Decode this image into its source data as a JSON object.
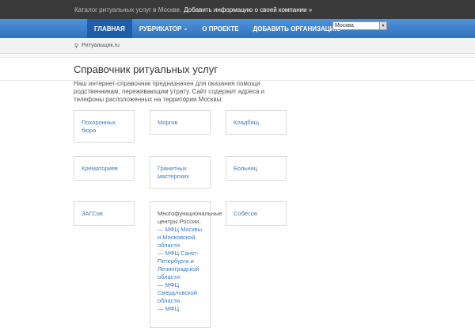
{
  "topbar": {
    "text": "Каталог ритуальных услуг в Москве.",
    "link": "Добавить информацию о своей компании »"
  },
  "nav": {
    "items": [
      {
        "label": "Главная",
        "active": true
      },
      {
        "label": "Рубрикатор",
        "dropdown": true,
        "chevron": "⌄"
      },
      {
        "label": "О проекте"
      },
      {
        "label": "Добавить организацию"
      }
    ],
    "city": "Москва"
  },
  "breadcrumb": {
    "icon": "map-marker-icon",
    "label": "Ритуальщик.ru"
  },
  "page": {
    "title": "Справочник ритуальных услуг",
    "intro": "Наш интернет-справочник предназначен для оказания помощи родственникам, переживающим утрату. Сайт содержит адреса и телефоны расположенных на территории Москвы:"
  },
  "cards": [
    {
      "label": "Похоронных бюро"
    },
    {
      "label": "Моргов"
    },
    {
      "label": "Кладбищ"
    },
    {
      "label": "Крематориев"
    },
    {
      "label": "Гранитных мастерских"
    },
    {
      "label": "Больниц"
    },
    {
      "label": "ЗАГСов"
    },
    {
      "label": "Многофункциональные центры России:",
      "links": [
        "— МФЦ Москвы и Московской области",
        "— МФЦ Санкт-Петербурга и Ленинградской области",
        "— МФЦ Свердловской области",
        "— МФЦ"
      ]
    },
    {
      "label": "Собесов"
    }
  ],
  "colors": {
    "nav": "#3a7fcf",
    "link": "#3d7bbd",
    "topbar": "#3a3a3a"
  }
}
